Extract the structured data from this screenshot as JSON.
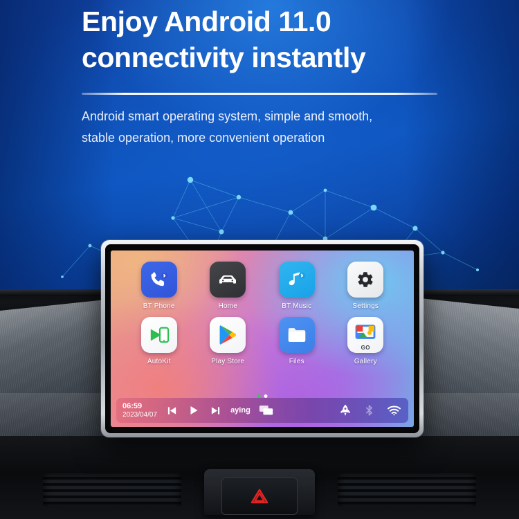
{
  "header": {
    "headline_line1": "Enjoy Android 11.0",
    "headline_line2": "connectivity instantly",
    "subtitle_line1": "Android smart operating system, simple and smooth,",
    "subtitle_line2": "stable operation, more convenient operation"
  },
  "colors": {
    "hero_blue": "#0c53bd",
    "hero_blue_dark": "#07316f",
    "headline_text": "#ffffff",
    "subtitle_text": "#e8eefb",
    "divider": "#ffffff",
    "accent_green": "#34c759",
    "bt_phone_tile": "#3d67e8",
    "home_tile": "#44464a",
    "bt_music_tile": "#31b5f0",
    "settings_tile": "#fbfbfc",
    "files_tile": "#4e93f2",
    "hazard_red": "#e02424"
  },
  "device": {
    "apps": [
      {
        "id": "bt-phone",
        "label": "BT Phone",
        "icon": "bluetooth-phone-icon"
      },
      {
        "id": "home",
        "label": "Home",
        "icon": "car-icon"
      },
      {
        "id": "bt-music",
        "label": "BT Music",
        "icon": "bluetooth-music-icon"
      },
      {
        "id": "settings",
        "label": "Settings",
        "icon": "gear-icon"
      },
      {
        "id": "autokit",
        "label": "AutoKit",
        "icon": "autokit-phone-play-icon"
      },
      {
        "id": "play-store",
        "label": "Play Store",
        "icon": "play-store-icon"
      },
      {
        "id": "files",
        "label": "Files",
        "icon": "folder-icon"
      },
      {
        "id": "gallery",
        "label": "Gallery",
        "icon": "gallery-photos-icon",
        "badge": "GO"
      }
    ],
    "page_indicator": {
      "total": 2,
      "active": 1
    },
    "statusbar": {
      "time": "06:59",
      "date": "2023/04/07",
      "track_text": "aying",
      "controls": [
        {
          "id": "previous",
          "icon": "skip-previous-icon"
        },
        {
          "id": "play",
          "icon": "play-icon"
        },
        {
          "id": "next",
          "icon": "skip-next-icon"
        }
      ],
      "tray_icons": [
        {
          "id": "recents",
          "icon": "recent-apps-icon",
          "state": "on"
        },
        {
          "id": "boost",
          "icon": "rocket-icon",
          "state": "on"
        },
        {
          "id": "bluetooth",
          "icon": "bluetooth-icon",
          "state": "off"
        },
        {
          "id": "wifi",
          "icon": "wifi-icon",
          "state": "on"
        }
      ]
    }
  },
  "dashboard": {
    "hazard_button_label": "hazard-warning",
    "vent_left_label": "air-vent-left",
    "vent_right_label": "air-vent-right"
  }
}
